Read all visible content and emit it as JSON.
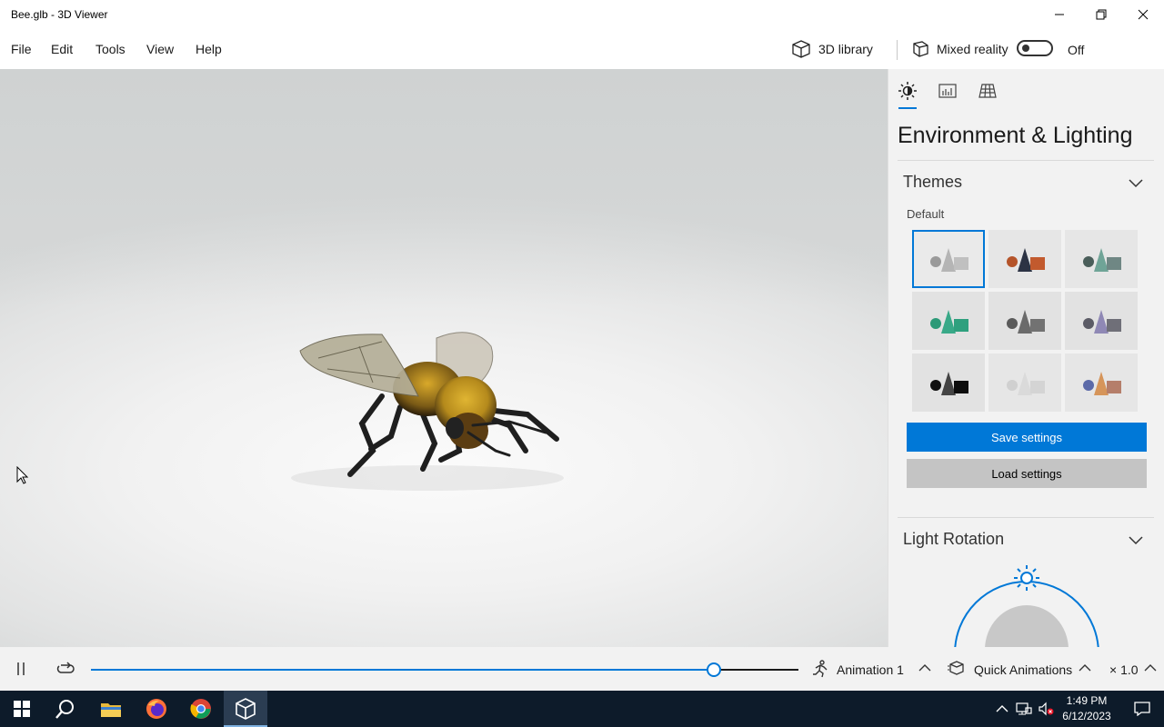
{
  "window": {
    "title": "Bee.glb - 3D Viewer"
  },
  "menu": {
    "items": [
      "File",
      "Edit",
      "Tools",
      "View",
      "Help"
    ]
  },
  "toolbar": {
    "library_label": "3D library",
    "mixed_reality_label": "Mixed reality",
    "mixed_reality_state": "Off"
  },
  "panel": {
    "title": "Environment & Lighting",
    "tabs": [
      "environment-lighting",
      "stats-shading",
      "grid-views"
    ],
    "themes": {
      "title": "Themes",
      "selected_name": "Default",
      "tile_count": 9,
      "selected_index": 0
    },
    "save_label": "Save settings",
    "load_label": "Load settings",
    "light_rotation_title": "Light Rotation"
  },
  "playback": {
    "animation_name": "Animation 1",
    "quick_animations_label": "Quick Animations",
    "speed_label": "× 1.0",
    "progress": 0.88
  },
  "taskbar": {
    "time": "1:49 PM",
    "date": "6/12/2023",
    "apps": [
      "start",
      "search",
      "file-explorer",
      "firefox",
      "chrome",
      "3d-viewer"
    ]
  },
  "colors": {
    "accent": "#0078d7",
    "taskbar": "#0d1b2a"
  }
}
